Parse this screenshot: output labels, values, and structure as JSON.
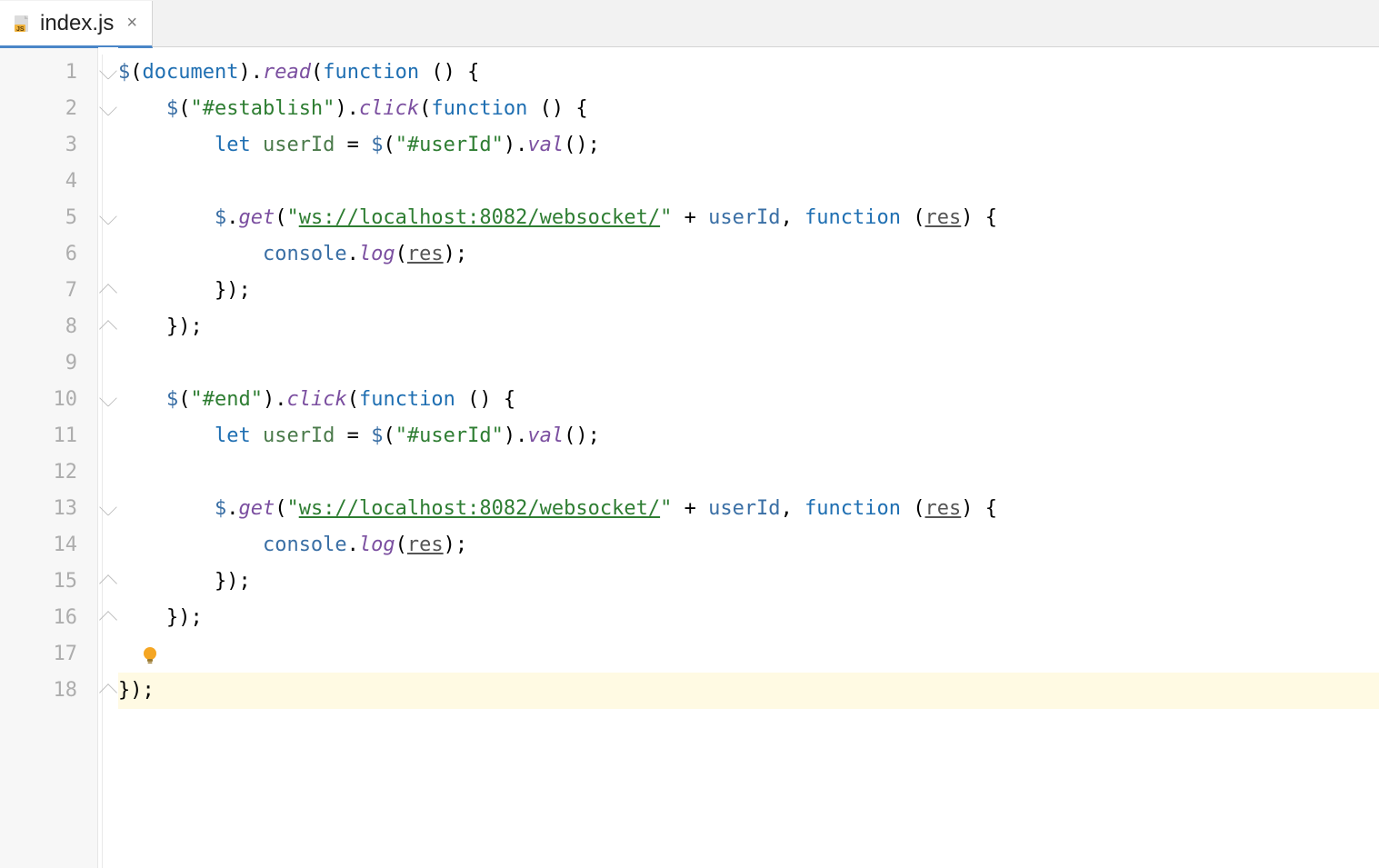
{
  "tab": {
    "filename": "index.js",
    "icon": "javascript-file-icon",
    "close_tooltip": "Close"
  },
  "editor": {
    "line_count": 18,
    "current_line": 18,
    "intention_bulb_line": 17,
    "fold_open_rows": [
      1,
      2,
      5,
      10,
      13
    ],
    "fold_close_rows": [
      7,
      8,
      15,
      16,
      18
    ],
    "lines": [
      {
        "indent": 0,
        "tokens": [
          [
            "id",
            "$"
          ],
          [
            "def",
            "("
          ],
          [
            "doc",
            "document"
          ],
          [
            "def",
            ")."
          ],
          [
            "prop",
            "read"
          ],
          [
            "def",
            "("
          ],
          [
            "kw",
            "function"
          ],
          [
            "def",
            " () {"
          ]
        ]
      },
      {
        "indent": 1,
        "tokens": [
          [
            "id",
            "$"
          ],
          [
            "def",
            "("
          ],
          [
            "str",
            "\"#establish\""
          ],
          [
            "def",
            ")."
          ],
          [
            "prop",
            "click"
          ],
          [
            "def",
            "("
          ],
          [
            "kw",
            "function"
          ],
          [
            "def",
            " () {"
          ]
        ]
      },
      {
        "indent": 2,
        "tokens": [
          [
            "kw",
            "let "
          ],
          [
            "var",
            "userId"
          ],
          [
            "def",
            " = "
          ],
          [
            "id",
            "$"
          ],
          [
            "def",
            "("
          ],
          [
            "str",
            "\"#userId\""
          ],
          [
            "def",
            ")."
          ],
          [
            "prop",
            "val"
          ],
          [
            "def",
            "();"
          ]
        ]
      },
      {
        "indent": 0,
        "tokens": []
      },
      {
        "indent": 2,
        "tokens": [
          [
            "id",
            "$"
          ],
          [
            "def",
            "."
          ],
          [
            "prop",
            "get"
          ],
          [
            "def",
            "("
          ],
          [
            "str",
            "\""
          ],
          [
            "strU",
            "ws://localhost:8082/websocket/"
          ],
          [
            "str",
            "\""
          ],
          [
            "def",
            " + "
          ],
          [
            "id",
            "userId"
          ],
          [
            "def",
            ", "
          ],
          [
            "kw",
            "function"
          ],
          [
            "def",
            " ("
          ],
          [
            "parm",
            "res"
          ],
          [
            "def",
            ") {"
          ]
        ]
      },
      {
        "indent": 3,
        "tokens": [
          [
            "id",
            "console"
          ],
          [
            "def",
            "."
          ],
          [
            "prop",
            "log"
          ],
          [
            "def",
            "("
          ],
          [
            "parm",
            "res"
          ],
          [
            "def",
            ");"
          ]
        ]
      },
      {
        "indent": 2,
        "tokens": [
          [
            "def",
            "});"
          ]
        ]
      },
      {
        "indent": 1,
        "tokens": [
          [
            "def",
            "});"
          ]
        ]
      },
      {
        "indent": 0,
        "tokens": []
      },
      {
        "indent": 1,
        "tokens": [
          [
            "id",
            "$"
          ],
          [
            "def",
            "("
          ],
          [
            "str",
            "\"#end\""
          ],
          [
            "def",
            ")."
          ],
          [
            "prop",
            "click"
          ],
          [
            "def",
            "("
          ],
          [
            "kw",
            "function"
          ],
          [
            "def",
            " () {"
          ]
        ]
      },
      {
        "indent": 2,
        "tokens": [
          [
            "kw",
            "let "
          ],
          [
            "var",
            "userId"
          ],
          [
            "def",
            " = "
          ],
          [
            "id",
            "$"
          ],
          [
            "def",
            "("
          ],
          [
            "str",
            "\"#userId\""
          ],
          [
            "def",
            ")."
          ],
          [
            "prop",
            "val"
          ],
          [
            "def",
            "();"
          ]
        ]
      },
      {
        "indent": 0,
        "tokens": []
      },
      {
        "indent": 2,
        "tokens": [
          [
            "id",
            "$"
          ],
          [
            "def",
            "."
          ],
          [
            "prop",
            "get"
          ],
          [
            "def",
            "("
          ],
          [
            "str",
            "\""
          ],
          [
            "strU",
            "ws://localhost:8082/websocket/"
          ],
          [
            "str",
            "\""
          ],
          [
            "def",
            " + "
          ],
          [
            "id",
            "userId"
          ],
          [
            "def",
            ", "
          ],
          [
            "kw",
            "function"
          ],
          [
            "def",
            " ("
          ],
          [
            "parm",
            "res"
          ],
          [
            "def",
            ") {"
          ]
        ]
      },
      {
        "indent": 3,
        "tokens": [
          [
            "id",
            "console"
          ],
          [
            "def",
            "."
          ],
          [
            "prop",
            "log"
          ],
          [
            "def",
            "("
          ],
          [
            "parm",
            "res"
          ],
          [
            "def",
            ");"
          ]
        ]
      },
      {
        "indent": 2,
        "tokens": [
          [
            "def",
            "});"
          ]
        ]
      },
      {
        "indent": 1,
        "tokens": [
          [
            "def",
            "});"
          ]
        ]
      },
      {
        "indent": 0,
        "tokens": []
      },
      {
        "indent": 0,
        "tokens": [
          [
            "def",
            "});"
          ]
        ]
      }
    ]
  }
}
